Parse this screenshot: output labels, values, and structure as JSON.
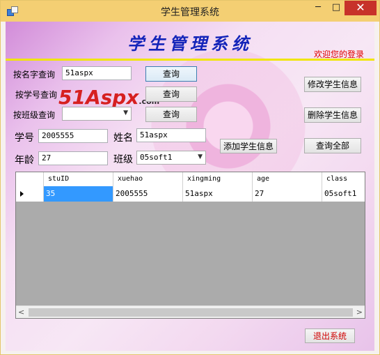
{
  "window": {
    "title": "学生管理系统",
    "minimize": "─",
    "maximize": "□",
    "close": "✕"
  },
  "header": {
    "title": "学生管理系统",
    "welcome": "欢迎您的登录"
  },
  "logo": {
    "brand_number": "51",
    "brand_name": "Aspx",
    "brand_suffix": ".com"
  },
  "search": {
    "by_name_label": "按名字查询",
    "by_name_value": "51aspx",
    "by_id_label": "按学号查询",
    "by_id_value": "",
    "by_class_label": "按班级查询",
    "by_class_value": "",
    "query_button": "查询"
  },
  "form": {
    "id_label": "学号",
    "id_value": "2005555",
    "name_label": "姓名",
    "name_value": "51aspx",
    "age_label": "年龄",
    "age_value": "27",
    "class_label": "班级",
    "class_value": "05soft1"
  },
  "actions": {
    "modify": "修改学生信息",
    "delete": "删除学生信息",
    "add": "添加学生信息",
    "query_all": "查询全部",
    "exit": "退出系统"
  },
  "grid": {
    "columns": [
      "stuID",
      "xuehao",
      "xingming",
      "age",
      "class"
    ],
    "rows": [
      {
        "stuID": "35",
        "xuehao": "2005555",
        "xingming": "51aspx",
        "age": "27",
        "class": "05soft1"
      }
    ],
    "scroll_left": "<",
    "scroll_right": ">"
  }
}
